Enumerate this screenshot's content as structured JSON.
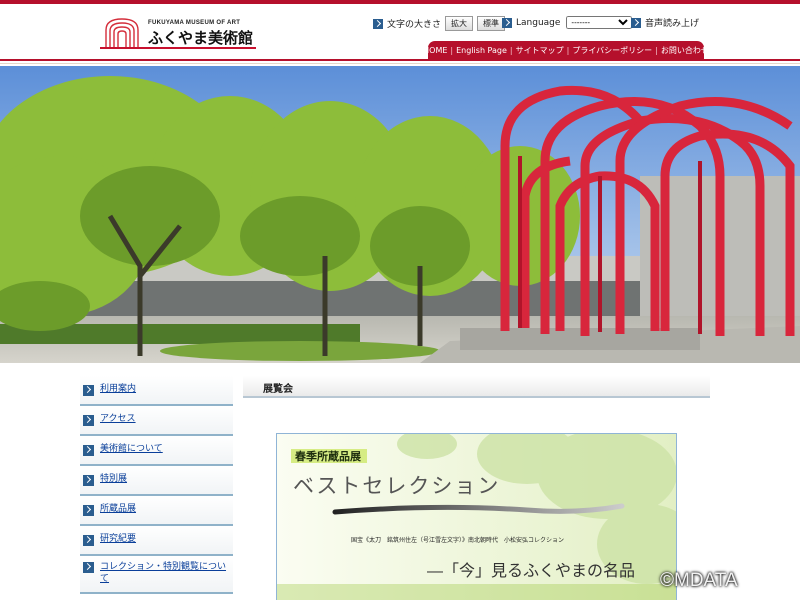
{
  "header": {
    "logo_sub": "FUKUYAMA MUSEUM OF ART",
    "logo_title": "ふくやま美術館",
    "font_size_label": "文字の大きさ",
    "font_size_buttons": [
      "拡大",
      "標準"
    ],
    "language_label": "Language",
    "language_selected": "-------",
    "voice_label": "音声読み上げ"
  },
  "nav": [
    "HOME",
    "English Page",
    "サイトマップ",
    "プライバシーポリシー",
    "お問い合わせ"
  ],
  "sidebar": {
    "items": [
      {
        "label": "利用案内"
      },
      {
        "label": "アクセス"
      },
      {
        "label": "美術館について"
      },
      {
        "label": "特別展"
      },
      {
        "label": "所蔵品展"
      },
      {
        "label": "研究紀要"
      },
      {
        "label": "コレクション・特別観覧について"
      }
    ]
  },
  "content": {
    "heading": "展覧会"
  },
  "banner": {
    "kicker": "春季所蔵品展",
    "title": "ベストセレクション",
    "caption": "国宝《太刀　銘筑州住左（号江雪左文字）》南北朝時代　小松安弘コレクション",
    "tagline": "―「今」見るふくやまの名品"
  },
  "watermark": "©MDATA",
  "colors": {
    "brand_red": "#b5102c",
    "link_blue": "#0a3f9a",
    "icon_blue": "#2a5d8f"
  }
}
